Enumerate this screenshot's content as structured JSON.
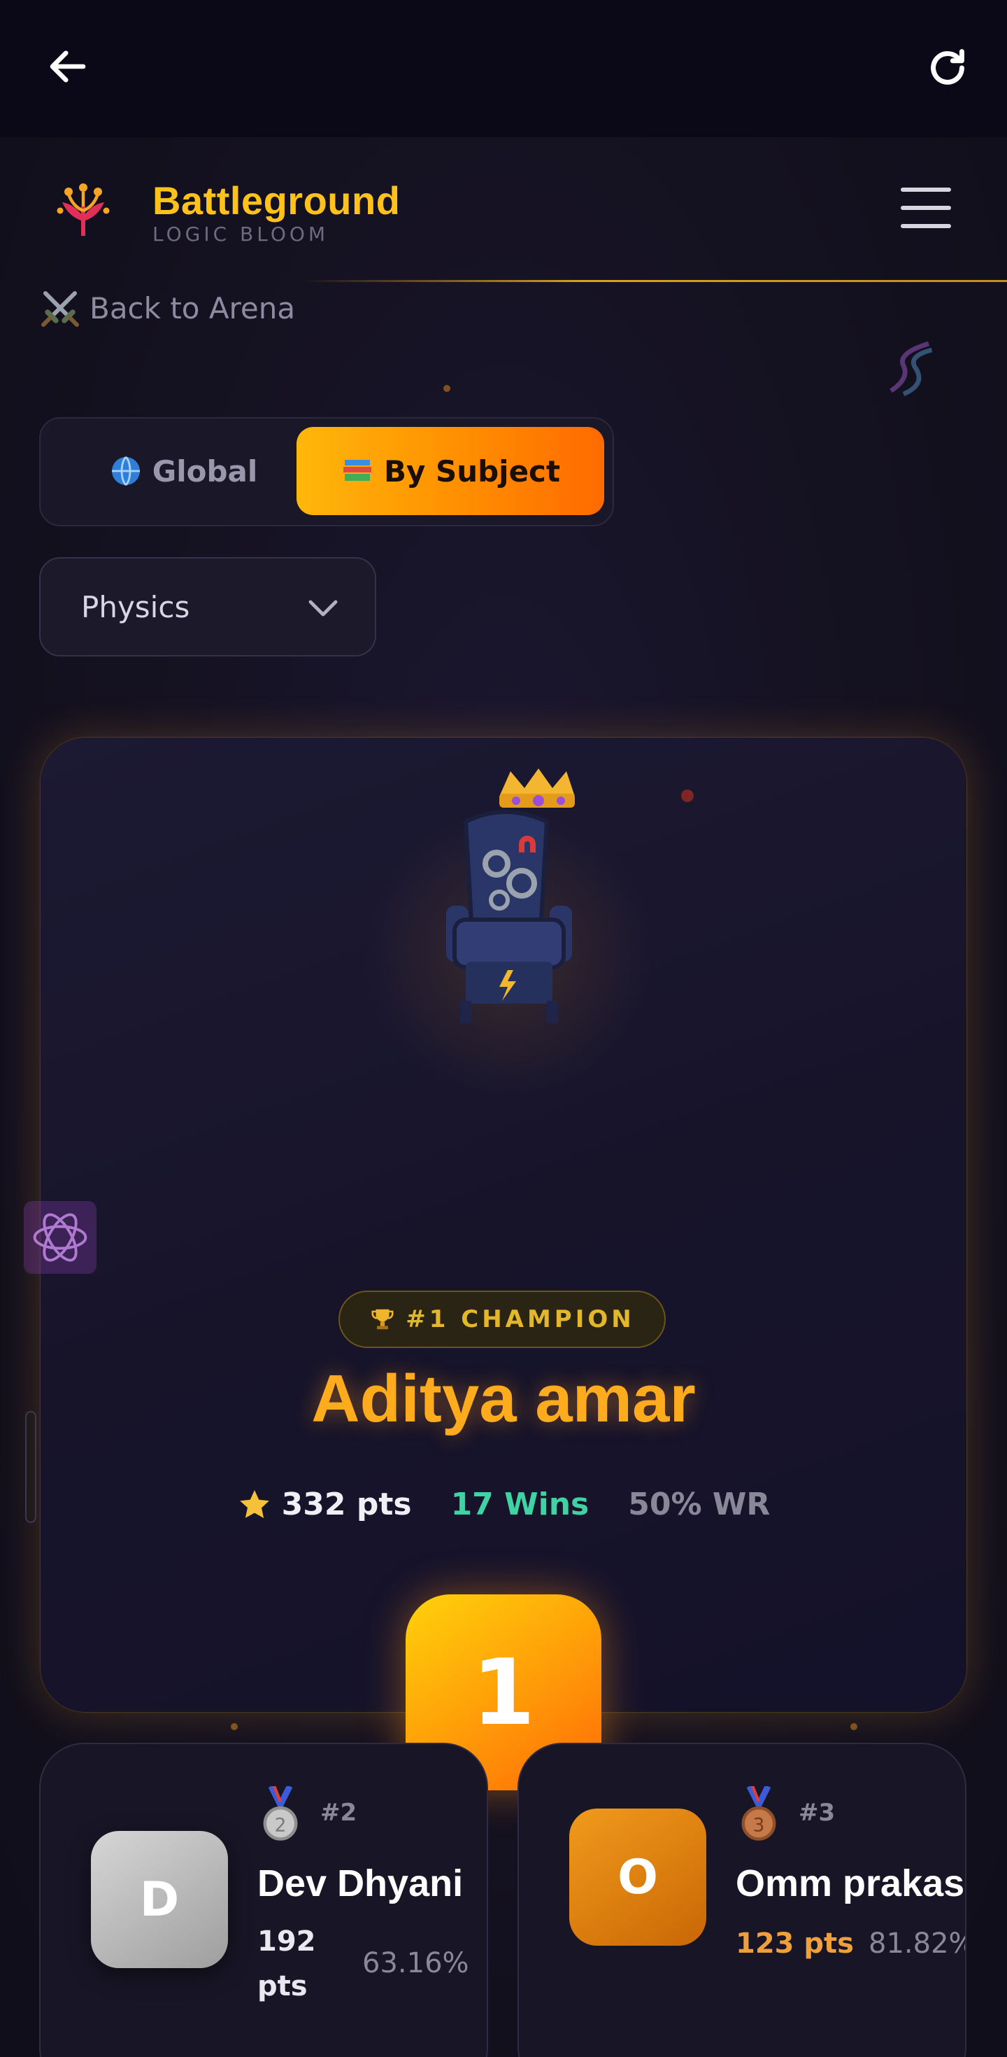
{
  "topbar": {
    "back_icon": "arrow-left-icon",
    "refresh_icon": "refresh-icon"
  },
  "header": {
    "title": "Battleground",
    "subtitle": "LOGIC BLOOM",
    "logo_icon": "lotus-logo-icon",
    "menu_icon": "hamburger-menu-icon"
  },
  "back_link": {
    "label": "Back to Arena",
    "icon": "crossed-swords-icon"
  },
  "tabs": [
    {
      "label": "Global",
      "icon": "globe-icon",
      "active": false
    },
    {
      "label": "By Subject",
      "icon": "books-icon",
      "active": true
    }
  ],
  "subject_select": {
    "value": "Physics"
  },
  "champion": {
    "badge": "#1 CHAMPION",
    "name": "Aditya amar",
    "points": "332 pts",
    "wins": "17 Wins",
    "win_rate": "50% WR",
    "rank": "1"
  },
  "runners": [
    {
      "rank": "#2",
      "initial": "D",
      "name": "Dev Dhyani",
      "points": "192 pts",
      "win_rate": "63.16%"
    },
    {
      "rank": "#3",
      "initial": "O",
      "name": "Omm prakas",
      "points": "123 pts",
      "win_rate": "81.82%"
    }
  ],
  "colors": {
    "accent": "#ffc21a",
    "orange": "#ff8a00",
    "wins": "#3fd3a4",
    "background": "#13111f"
  }
}
